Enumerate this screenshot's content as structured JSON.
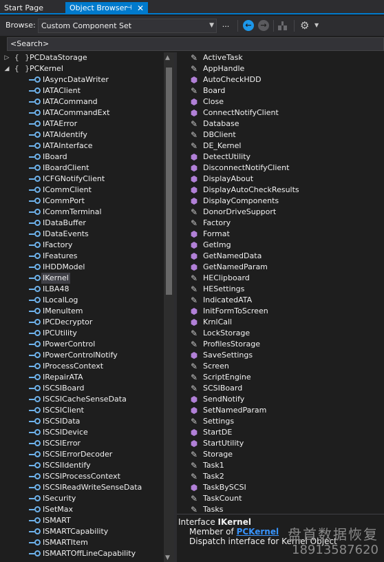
{
  "tabs": {
    "start": "Start Page",
    "active": "Object Browser",
    "pin_glyph": "⊣",
    "close_glyph": "✕"
  },
  "toolbar": {
    "browse_label": "Browse:",
    "browse_value": "Custom Component Set",
    "ellipsis": "..."
  },
  "search": {
    "value": "<Search>"
  },
  "tree": {
    "namespaces": [
      {
        "name": "PCDataStorage",
        "expanded": false
      },
      {
        "name": "PCKernel",
        "expanded": true
      }
    ],
    "items": [
      "IAsyncDataWriter",
      "IATAClient",
      "IATACommand",
      "IATACommandExt",
      "IATAError",
      "IATAIdentify",
      "IATAInterface",
      "IBoard",
      "IBoardClient",
      "ICFGNotifyClient",
      "ICommClient",
      "ICommPort",
      "ICommTerminal",
      "IDataBuffer",
      "IDataEvents",
      "IFactory",
      "IFeatures",
      "IHDDModel",
      "IKernel",
      "ILBA48",
      "ILocalLog",
      "IMenuItem",
      "IPCDecryptor",
      "IPCUtility",
      "IPowerControl",
      "IPowerControlNotify",
      "IProcessContext",
      "IRepairATA",
      "ISCSIBoard",
      "ISCSICacheSenseData",
      "ISCSIClient",
      "ISCSIData",
      "ISCSIDevice",
      "ISCSIError",
      "ISCSIErrorDecoder",
      "ISCSIIdentify",
      "ISCSIProcessContext",
      "ISCSIReadWriteSenseData",
      "ISecurity",
      "ISetMax",
      "ISMART",
      "ISMARTCapability",
      "ISMARTItem",
      "ISMARTOffLineCapability"
    ],
    "selected": "IKernel"
  },
  "members": [
    {
      "name": "ActiveTask",
      "icon": "wrench"
    },
    {
      "name": "AppHandle",
      "icon": "wrench"
    },
    {
      "name": "AutoCheckHDD",
      "icon": "cube"
    },
    {
      "name": "Board",
      "icon": "wrench"
    },
    {
      "name": "Close",
      "icon": "cube"
    },
    {
      "name": "ConnectNotifyClient",
      "icon": "cube"
    },
    {
      "name": "Database",
      "icon": "wrench"
    },
    {
      "name": "DBClient",
      "icon": "wrench"
    },
    {
      "name": "DE_Kernel",
      "icon": "wrench"
    },
    {
      "name": "DetectUtility",
      "icon": "cube"
    },
    {
      "name": "DisconnectNotifyClient",
      "icon": "cube"
    },
    {
      "name": "DisplayAbout",
      "icon": "cube"
    },
    {
      "name": "DisplayAutoCheckResults",
      "icon": "cube"
    },
    {
      "name": "DisplayComponents",
      "icon": "cube"
    },
    {
      "name": "DonorDriveSupport",
      "icon": "wrench"
    },
    {
      "name": "Factory",
      "icon": "wrench"
    },
    {
      "name": "Format",
      "icon": "cube"
    },
    {
      "name": "GetImg",
      "icon": "cube"
    },
    {
      "name": "GetNamedData",
      "icon": "cube"
    },
    {
      "name": "GetNamedParam",
      "icon": "cube"
    },
    {
      "name": "HEClipboard",
      "icon": "wrench"
    },
    {
      "name": "HESettings",
      "icon": "wrench"
    },
    {
      "name": "IndicatedATA",
      "icon": "wrench"
    },
    {
      "name": "InitFormToScreen",
      "icon": "cube"
    },
    {
      "name": "KrnlCall",
      "icon": "cube"
    },
    {
      "name": "LockStorage",
      "icon": "wrench"
    },
    {
      "name": "ProfilesStorage",
      "icon": "wrench"
    },
    {
      "name": "SaveSettings",
      "icon": "cube"
    },
    {
      "name": "Screen",
      "icon": "wrench"
    },
    {
      "name": "ScriptEngine",
      "icon": "wrench"
    },
    {
      "name": "SCSIBoard",
      "icon": "wrench"
    },
    {
      "name": "SendNotify",
      "icon": "cube"
    },
    {
      "name": "SetNamedParam",
      "icon": "cube"
    },
    {
      "name": "Settings",
      "icon": "wrench"
    },
    {
      "name": "StartDE",
      "icon": "cube"
    },
    {
      "name": "StartUtility",
      "icon": "cube"
    },
    {
      "name": "Storage",
      "icon": "wrench"
    },
    {
      "name": "Task1",
      "icon": "wrench"
    },
    {
      "name": "Task2",
      "icon": "wrench"
    },
    {
      "name": "TaskBySCSI",
      "icon": "cube"
    },
    {
      "name": "TaskCount",
      "icon": "wrench"
    },
    {
      "name": "Tasks",
      "icon": "wrench"
    }
  ],
  "description": {
    "prefix": "Interface ",
    "name": "IKernel",
    "member_of_label": "Member of ",
    "member_of_link": "PCKernel",
    "summary": "Dispatch interface for Kernel Object"
  },
  "watermark": {
    "cn": "盘首数据恢复",
    "phone": "18913587620"
  }
}
